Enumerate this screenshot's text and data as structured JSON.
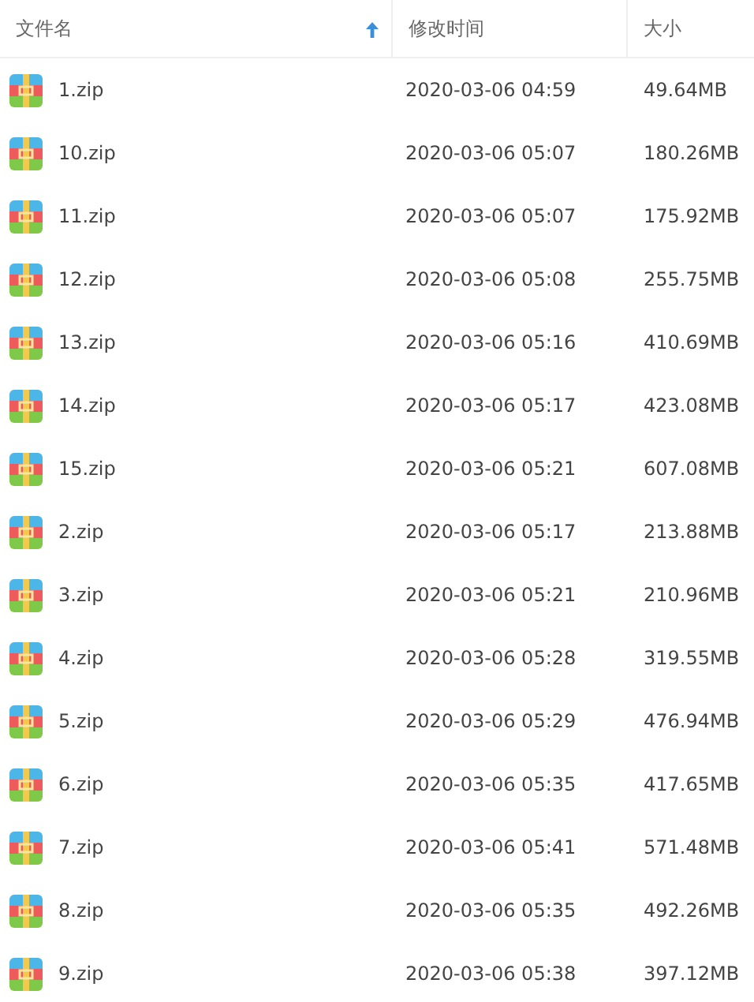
{
  "columns": [
    {
      "label": "文件名",
      "sorted": true
    },
    {
      "label": "修改时间",
      "sorted": false
    },
    {
      "label": "大小",
      "sorted": false
    }
  ],
  "rows": [
    {
      "name": "1.zip",
      "modified": "2020-03-06 04:59",
      "size": "49.64MB"
    },
    {
      "name": "10.zip",
      "modified": "2020-03-06 05:07",
      "size": "180.26MB"
    },
    {
      "name": "11.zip",
      "modified": "2020-03-06 05:07",
      "size": "175.92MB"
    },
    {
      "name": "12.zip",
      "modified": "2020-03-06 05:08",
      "size": "255.75MB"
    },
    {
      "name": "13.zip",
      "modified": "2020-03-06 05:16",
      "size": "410.69MB"
    },
    {
      "name": "14.zip",
      "modified": "2020-03-06 05:17",
      "size": "423.08MB"
    },
    {
      "name": "15.zip",
      "modified": "2020-03-06 05:21",
      "size": "607.08MB"
    },
    {
      "name": "2.zip",
      "modified": "2020-03-06 05:17",
      "size": "213.88MB"
    },
    {
      "name": "3.zip",
      "modified": "2020-03-06 05:21",
      "size": "210.96MB"
    },
    {
      "name": "4.zip",
      "modified": "2020-03-06 05:28",
      "size": "319.55MB"
    },
    {
      "name": "5.zip",
      "modified": "2020-03-06 05:29",
      "size": "476.94MB"
    },
    {
      "name": "6.zip",
      "modified": "2020-03-06 05:35",
      "size": "417.65MB"
    },
    {
      "name": "7.zip",
      "modified": "2020-03-06 05:41",
      "size": "571.48MB"
    },
    {
      "name": "8.zip",
      "modified": "2020-03-06 05:35",
      "size": "492.26MB"
    },
    {
      "name": "9.zip",
      "modified": "2020-03-06 05:38",
      "size": "397.12MB"
    }
  ]
}
